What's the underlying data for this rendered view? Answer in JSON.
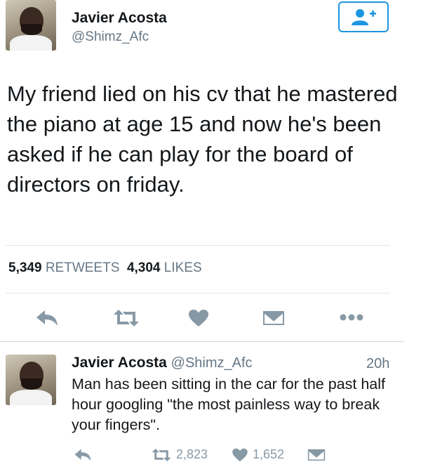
{
  "tweet": {
    "author_name": "Javier Acosta",
    "author_handle": "@Shimz_Afc",
    "text": "My friend lied on his cv that he mastered the piano at age 15 and now he's been asked if he can  play for the board of directors on friday.",
    "retweets_count": "5,349",
    "retweets_label": "RETWEETS",
    "likes_count": "4,304",
    "likes_label": "LIKES"
  },
  "reply": {
    "author_name": "Javier Acosta",
    "author_handle": "@Shimz_Afc",
    "time": "20h",
    "text": "Man has been sitting in the car for the past half hour googling \"the most painless way to break your fingers\".",
    "retweet_count": "2,823",
    "like_count": "1,652"
  },
  "colors": {
    "accent": "#1b95e0",
    "icon_gray": "#8899a6",
    "divider": "#e1e8ed"
  },
  "icons": [
    "follow-icon",
    "reply-icon",
    "retweet-icon",
    "like-icon",
    "dm-icon",
    "more-icon"
  ]
}
